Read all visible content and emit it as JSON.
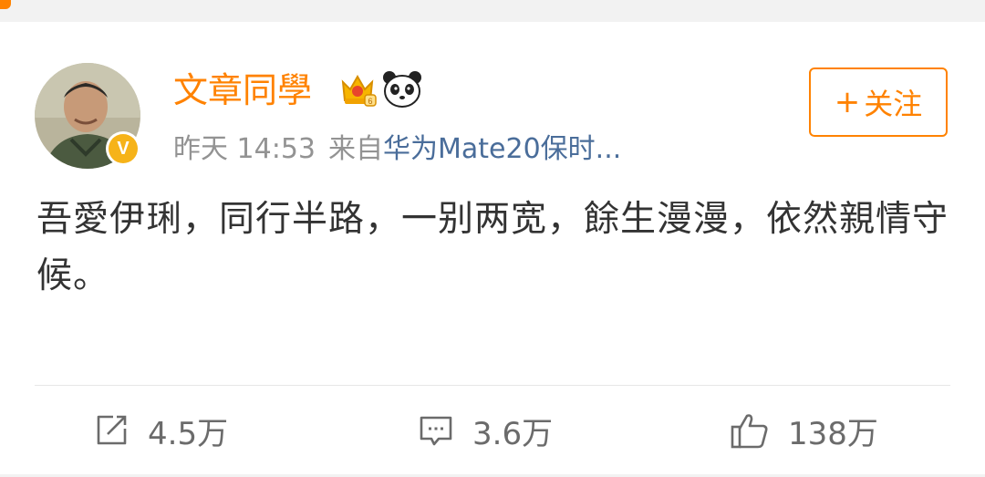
{
  "post": {
    "username": "文章同學",
    "time": "昨天 14:53",
    "source_prefix": "来自",
    "source": "华为Mate20保时...",
    "follow_label": "关注",
    "text": "吾愛伊琍，同行半路，一别两宽，餘生漫漫，依然親情守候。"
  },
  "actions": {
    "repost": "4.5万",
    "comment": "3.6万",
    "like": "138万"
  },
  "colors": {
    "accent": "#ff8200",
    "source_link": "#4a6d9a",
    "verified": "#f6b319"
  },
  "icons": [
    "crown-badge-icon",
    "panda-badge-icon",
    "verified-icon",
    "repost-icon",
    "comment-icon",
    "like-icon"
  ]
}
